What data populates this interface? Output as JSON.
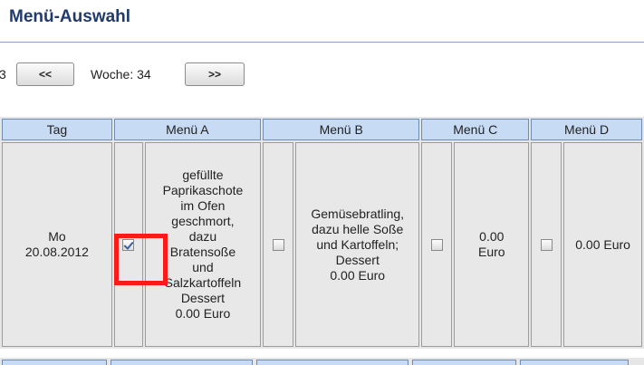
{
  "page": {
    "title": "Menü-Auswahl"
  },
  "week_nav": {
    "prefix": "3",
    "prev_label": "<<",
    "week_text": "Woche: 34",
    "next_label": ">>"
  },
  "table": {
    "headers": [
      "Tag",
      "Menü A",
      "Menü B",
      "Menü C",
      "Menü D"
    ],
    "rows": [
      {
        "day": "Mo",
        "date": "20.08.2012",
        "menu_a": {
          "checked": true,
          "lines": [
            "gefüllte",
            "Paprikaschote",
            "im Ofen",
            "geschmort,",
            "dazu",
            "Bratensoße",
            "und",
            "Salzkartoffeln",
            "Dessert",
            "0.00 Euro"
          ]
        },
        "menu_b": {
          "checked": false,
          "lines": [
            "Gemüsebratling,",
            "dazu helle Soße",
            "und Kartoffeln;",
            "Dessert",
            "0.00 Euro"
          ]
        },
        "menu_c": {
          "checked": false,
          "lines": [
            "0.00",
            "Euro"
          ]
        },
        "menu_d": {
          "checked": false,
          "lines": [
            "0.00 Euro"
          ]
        }
      }
    ]
  },
  "colors": {
    "title": "#1f3a6d",
    "header_bg": "#c7dbf4",
    "cell_bg": "#e8e8e8",
    "highlight": "#ff1a1a"
  }
}
